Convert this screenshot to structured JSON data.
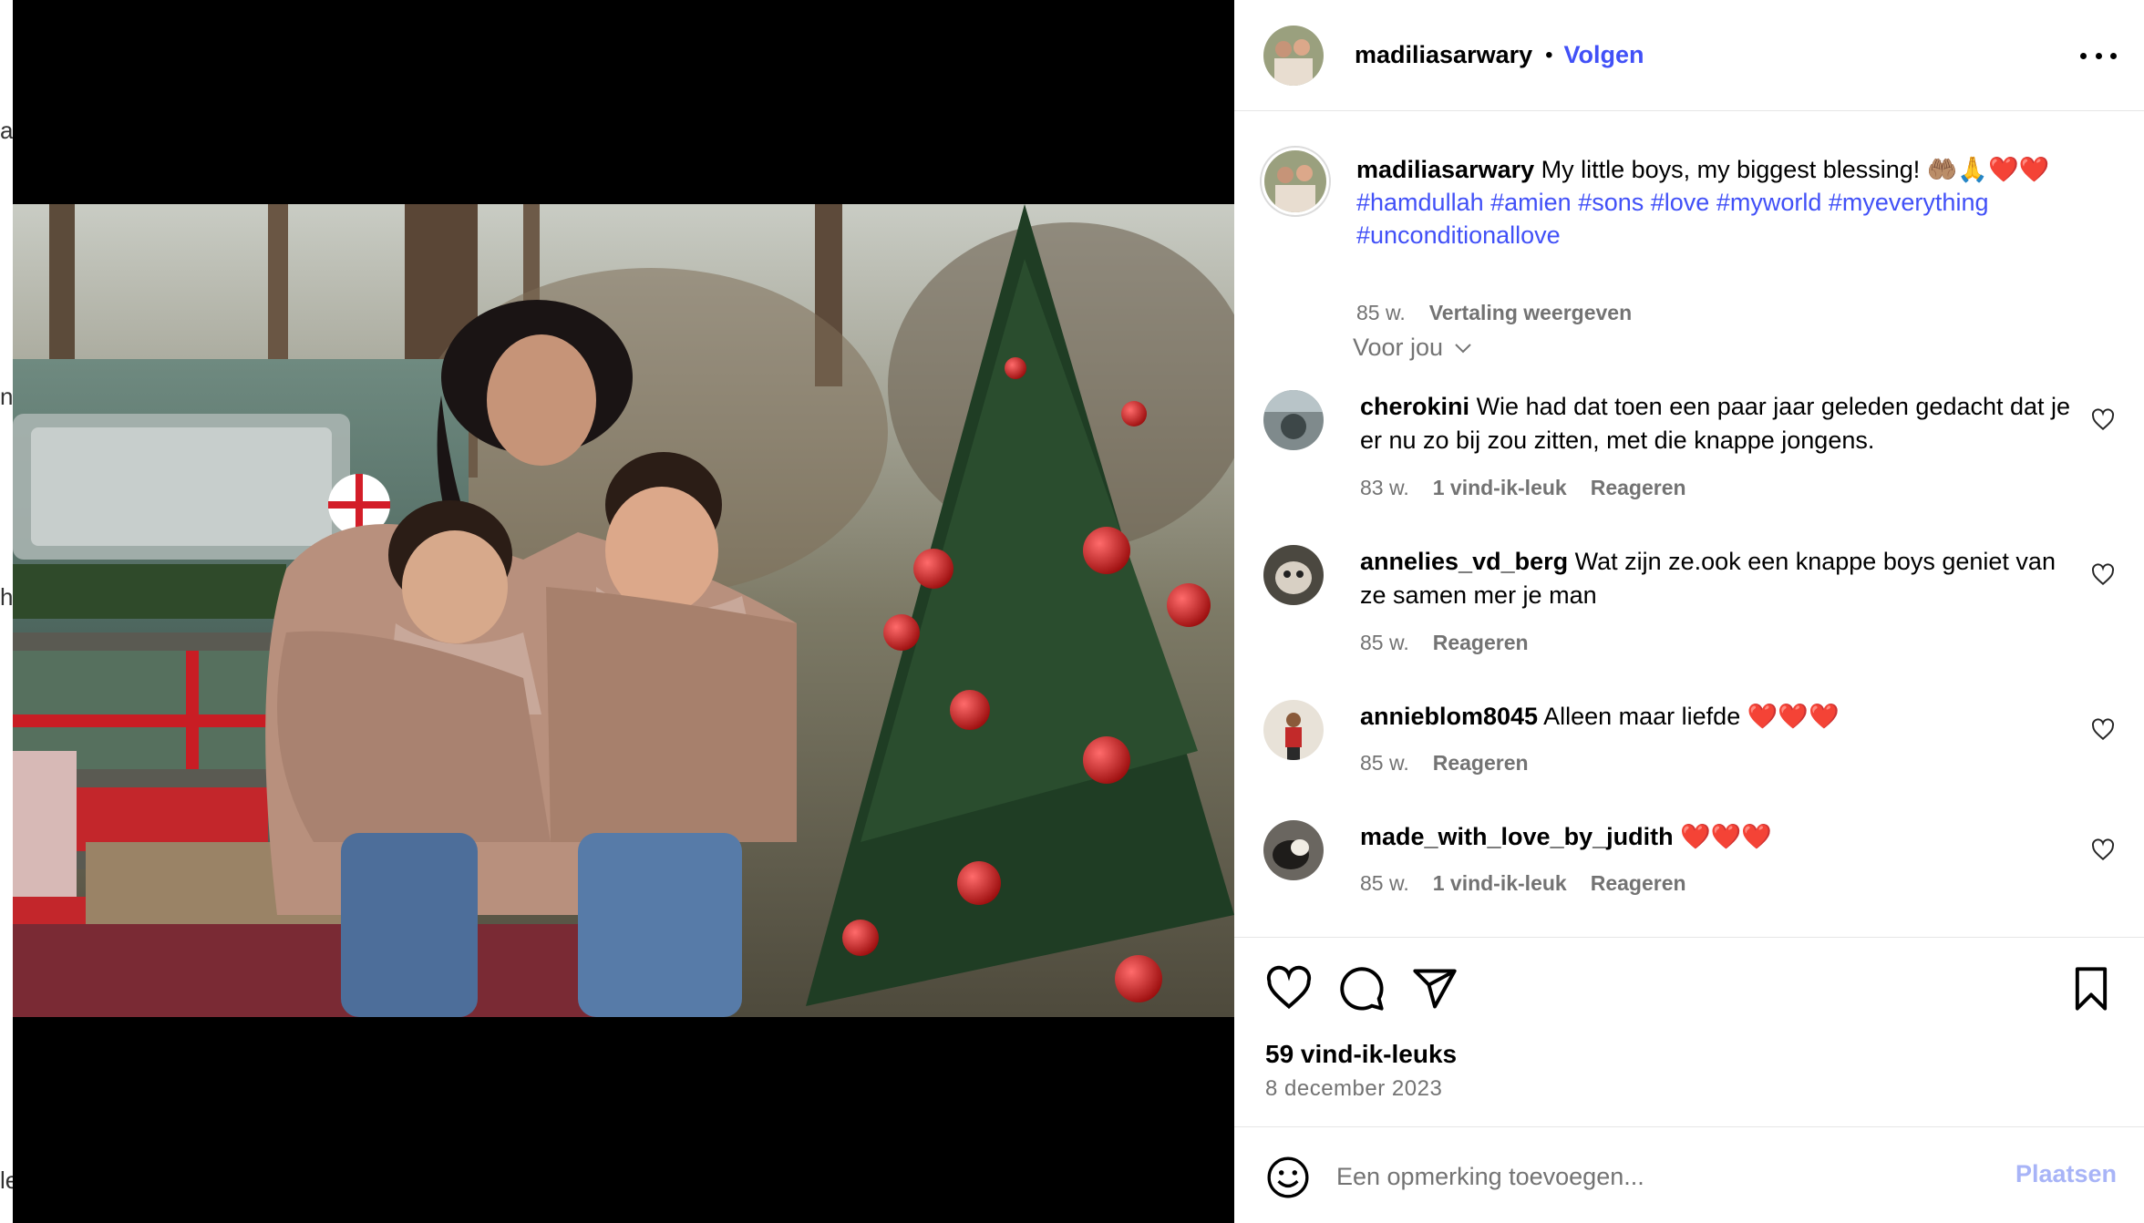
{
  "post": {
    "username": "madiliasarwary",
    "follow_label": "Volgen",
    "separator": "•"
  },
  "caption": {
    "username": "madiliasarwary",
    "text": "My little boys, my biggest blessing! 🤲🏽🙏❤️❤️",
    "hashtags": [
      "#hamdullah",
      "#amien",
      "#sons",
      "#love",
      "#myworld",
      "#myeverything",
      "#unconditionallove"
    ],
    "age": "85 w.",
    "translate_label": "Vertaling weergeven"
  },
  "sort_label": "Voor jou",
  "comments": [
    {
      "username": "cherokini",
      "text": "Wie had dat toen een paar jaar geleden gedacht dat je er nu zo bij zou zitten, met die knappe jongens.",
      "age": "83 w.",
      "likes": "1 vind-ik-leuk",
      "reply": "Reageren"
    },
    {
      "username": "annelies_vd_berg",
      "text": "Wat zijn ze.ook een knappe boys geniet van ze samen mer je man",
      "age": "85 w.",
      "likes": "",
      "reply": "Reageren"
    },
    {
      "username": "annieblom8045",
      "text": "Alleen maar liefde ❤️❤️❤️",
      "age": "85 w.",
      "likes": "",
      "reply": "Reageren"
    },
    {
      "username": "made_with_love_by_judith",
      "text": "❤️❤️❤️",
      "age": "85 w.",
      "likes": "1 vind-ik-leuk",
      "reply": "Reageren"
    }
  ],
  "stats": {
    "likes": "59 vind-ik-leuks",
    "date": "8 december 2023"
  },
  "composer": {
    "placeholder": "Een opmerking toevoegen...",
    "post_label": "Plaatsen"
  },
  "icons": [
    "more-icon",
    "heart-icon",
    "comment-icon",
    "share-icon",
    "bookmark-icon",
    "emoji-icon",
    "chevron-down-icon"
  ],
  "colors": {
    "link": "#4150f7",
    "muted": "#737373",
    "post_disabled": "#a8b4f7"
  }
}
